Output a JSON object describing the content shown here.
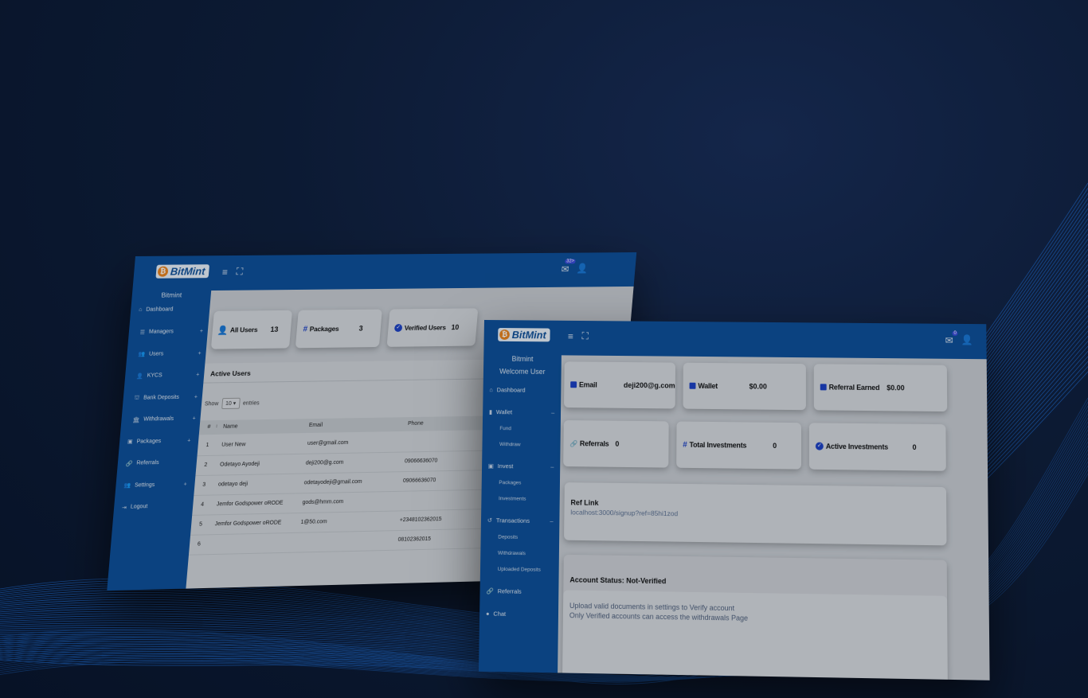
{
  "admin": {
    "brand": "BitMint",
    "site_name": "Bitmint",
    "badge_count": "32>",
    "nav": [
      {
        "label": "Dashboard",
        "icon": "home-icon"
      },
      {
        "label": "Managers",
        "icon": "list-icon"
      },
      {
        "label": "Users",
        "icon": "users-icon"
      },
      {
        "label": "KYCS",
        "icon": "user-check-icon"
      },
      {
        "label": "Bank Deposits",
        "icon": "bank-icon"
      },
      {
        "label": "Withdrawals",
        "icon": "withdraw-icon"
      },
      {
        "label": "Packages",
        "icon": "package-icon"
      },
      {
        "label": "Referrals",
        "icon": "link-icon"
      },
      {
        "label": "Settings",
        "icon": "settings-icon"
      },
      {
        "label": "Logout",
        "icon": "logout-icon"
      }
    ],
    "stats": [
      {
        "label": "All Users",
        "value": "13",
        "icon": "user-icon"
      },
      {
        "label": "Packages",
        "value": "3",
        "icon": "hash-icon"
      },
      {
        "label": "Verified Users",
        "value": "10",
        "icon": "check-circle-icon"
      }
    ],
    "table": {
      "title": "Active Users",
      "show_label": "Show",
      "entries_value": "10",
      "entries_label": "entries",
      "columns": [
        "#",
        "Name",
        "Email",
        "Phone"
      ],
      "rows": [
        {
          "n": "1",
          "name": "User New",
          "email": "user@gmail.com",
          "phone": ""
        },
        {
          "n": "2",
          "name": "Odetayo Ayodeji",
          "email": "deji200@g.com",
          "phone": "09066636070"
        },
        {
          "n": "3",
          "name": "odetayo deji",
          "email": "odetayodeji@gmail.com",
          "phone": "09066636070"
        },
        {
          "n": "4",
          "name": "Jemfor Godspower oRODE",
          "email": "gods@hmm.com",
          "phone": ""
        },
        {
          "n": "5",
          "name": "Jemfor Godspower oRODE",
          "email": "1@50.com",
          "phone": "+2348102362015"
        },
        {
          "n": "6",
          "name": "",
          "email": "",
          "phone": "08102362015"
        }
      ]
    }
  },
  "user": {
    "brand": "BitMint",
    "site_name": "Bitmint",
    "welcome": "Welcome User",
    "badge_count": "0",
    "nav": [
      {
        "label": "Dashboard",
        "icon": "home-icon",
        "type": "item"
      },
      {
        "label": "Wallet",
        "icon": "wallet-icon",
        "type": "item",
        "toggle": "–"
      },
      {
        "label": "Fund",
        "type": "sub"
      },
      {
        "label": "Withdraw",
        "type": "sub"
      },
      {
        "label": "Invest",
        "icon": "invest-icon",
        "type": "item",
        "toggle": "–"
      },
      {
        "label": "Packages",
        "type": "sub"
      },
      {
        "label": "Investments",
        "type": "sub"
      },
      {
        "label": "Transactions",
        "icon": "history-icon",
        "type": "item",
        "toggle": "–"
      },
      {
        "label": "Deposits",
        "type": "sub"
      },
      {
        "label": "Withdrawals",
        "type": "sub"
      },
      {
        "label": "Uploaded Deposits",
        "type": "sub"
      },
      {
        "label": "Referrals",
        "icon": "link-icon",
        "type": "item"
      },
      {
        "label": "Chat",
        "icon": "chat-icon",
        "type": "item"
      }
    ],
    "stats": [
      {
        "label": "Email",
        "value": "deji200@g.com",
        "icon": "square-icon"
      },
      {
        "label": "Wallet",
        "value": "$0.00",
        "icon": "square-icon"
      },
      {
        "label": "Referral Earned",
        "value": "$0.00",
        "icon": "square-icon"
      },
      {
        "label": "Referrals",
        "value": "0",
        "icon": "link-icon"
      },
      {
        "label": "Total Investments",
        "value": "0",
        "icon": "hash-icon"
      },
      {
        "label": "Active Investments",
        "value": "0",
        "icon": "check-circle-icon"
      }
    ],
    "ref": {
      "title": "Ref Link",
      "link": "localhost:3000/signup?ref=85hi1zod"
    },
    "account": {
      "status": "Account Status: Not-Verified",
      "line1": "Upload valid documents in settings to Verify account",
      "line2": "Only Verified accounts can access the withdrawals Page"
    }
  }
}
